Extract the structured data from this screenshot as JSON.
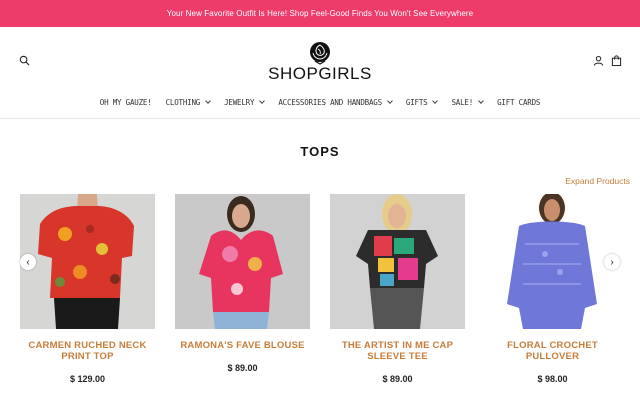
{
  "announcement": "Your New Favorite Outfit Is Here! Shop Feel-Good Finds You Won't See Everywhere",
  "brand": {
    "name": "SHOPGIRLS",
    "logo_icon": "rose-icon"
  },
  "header_icons": {
    "search": "search-icon",
    "account": "user-icon",
    "cart": "bag-icon"
  },
  "nav": [
    {
      "label": "OH MY GAUZE!",
      "dropdown": false
    },
    {
      "label": "CLOTHING",
      "dropdown": true
    },
    {
      "label": "JEWELRY",
      "dropdown": true
    },
    {
      "label": "ACCESSORIES AND HANDBAGS",
      "dropdown": true
    },
    {
      "label": "GIFTS",
      "dropdown": true
    },
    {
      "label": "SALE!",
      "dropdown": true
    },
    {
      "label": "GIFT CARDS",
      "dropdown": false
    }
  ],
  "section": {
    "title": "TOPS",
    "expand_label": "Expand Products"
  },
  "products": [
    {
      "name": "CARMEN RUCHED NECK PRINT TOP",
      "price": "$ 129.00"
    },
    {
      "name": "RAMONA'S FAVE BLOUSE",
      "price": "$ 89.00"
    },
    {
      "name": "THE ARTIST IN ME CAP SLEEVE TEE",
      "price": "$ 89.00"
    },
    {
      "name": "FLORAL CROCHET PULLOVER",
      "price": "$ 98.00"
    }
  ],
  "carousel": {
    "prev": "‹",
    "next": "›"
  },
  "colors": {
    "announcement_bg": "#ed3b6a",
    "accent": "#c77d3a"
  }
}
